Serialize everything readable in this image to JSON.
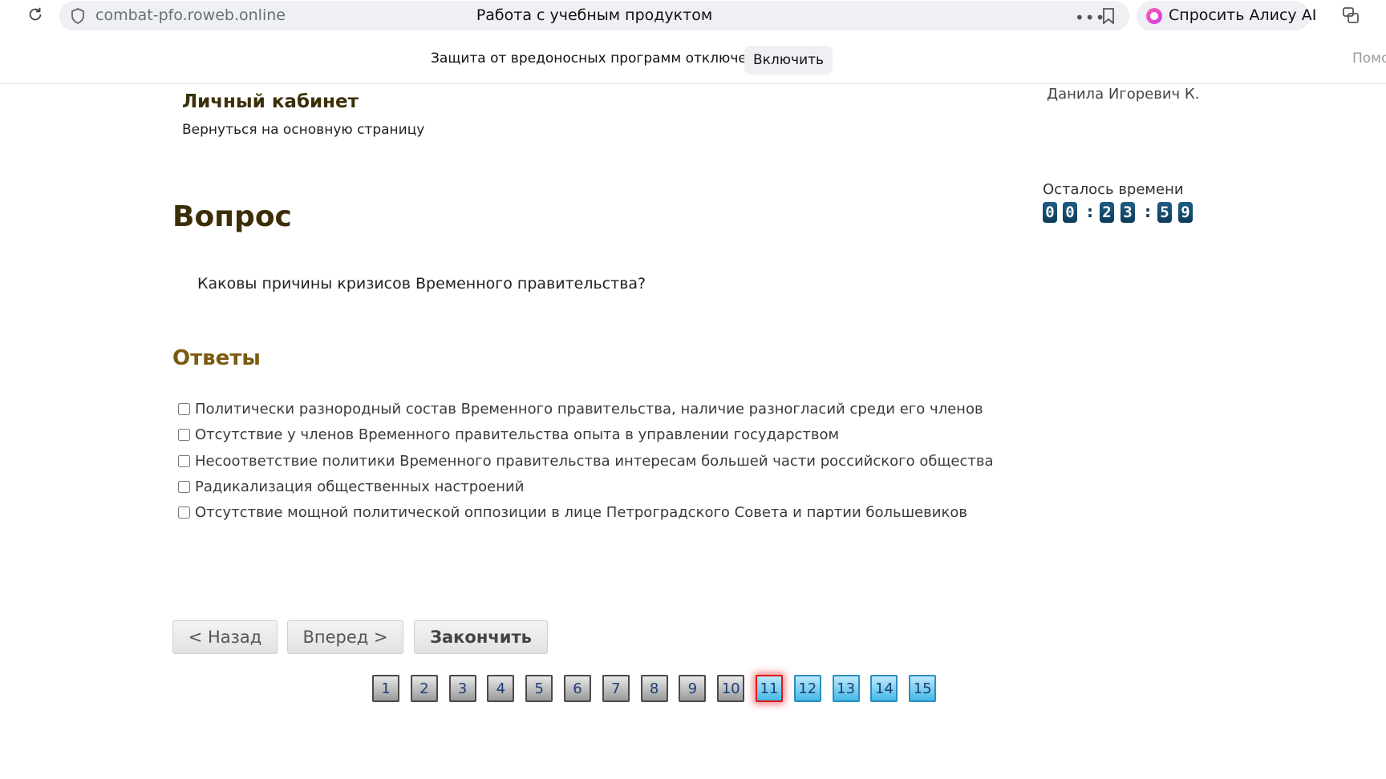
{
  "browser": {
    "url": "combat-pfo.roweb.online",
    "title": "Работа с учебным продуктом",
    "alice_label": "Спросить Алису AI"
  },
  "notification": {
    "text": "Защита от вредоносных программ отключена",
    "enable_label": "Включить",
    "help_label": "Помо"
  },
  "header": {
    "cabinet_title": "Личный кабинет",
    "back_link": "Вернуться на основную страницу",
    "user_name": "Данила Игоревич К."
  },
  "timer": {
    "label": "Осталось времени",
    "value": "00:23:59",
    "digits": [
      "0",
      "0",
      "2",
      "3",
      "5",
      "9"
    ]
  },
  "question": {
    "heading": "Вопрос",
    "text": "Каковы причины кризисов Временного правительства?"
  },
  "answers": {
    "heading": "Ответы",
    "items": [
      {
        "text": "Политически разнородный состав Временного правительства, наличие разногласий среди его членов",
        "checked": false
      },
      {
        "text": "Отсутствие у членов Временного правительства опыта в управлении государством",
        "checked": false
      },
      {
        "text": "Несоответствие политики Временного правительства интересам большей части российского общества",
        "checked": false
      },
      {
        "text": "Радикализация общественных настроений",
        "checked": false
      },
      {
        "text": "Отсутствие мощной политической оппозиции в лице Петроградского Совета и партии большевиков",
        "checked": false
      }
    ]
  },
  "nav": {
    "back_label": "< Назад",
    "forward_label": "Вперед >",
    "finish_label": "Закончить"
  },
  "pagination": {
    "current": 11,
    "pages": [
      {
        "label": "1",
        "state": "done"
      },
      {
        "label": "2",
        "state": "done"
      },
      {
        "label": "3",
        "state": "done"
      },
      {
        "label": "4",
        "state": "done"
      },
      {
        "label": "5",
        "state": "done"
      },
      {
        "label": "6",
        "state": "done"
      },
      {
        "label": "7",
        "state": "done"
      },
      {
        "label": "8",
        "state": "done"
      },
      {
        "label": "9",
        "state": "done"
      },
      {
        "label": "10",
        "state": "done"
      },
      {
        "label": "11",
        "state": "current"
      },
      {
        "label": "12",
        "state": "todo"
      },
      {
        "label": "13",
        "state": "todo"
      },
      {
        "label": "14",
        "state": "todo"
      },
      {
        "label": "15",
        "state": "todo"
      }
    ]
  },
  "colors": {
    "heading": "#3c2f08",
    "answers_heading": "#7a5a10",
    "timer_digit": "#0d3c5a",
    "page_current_border": "#e0171b",
    "page_todo": "#43b8e6"
  }
}
